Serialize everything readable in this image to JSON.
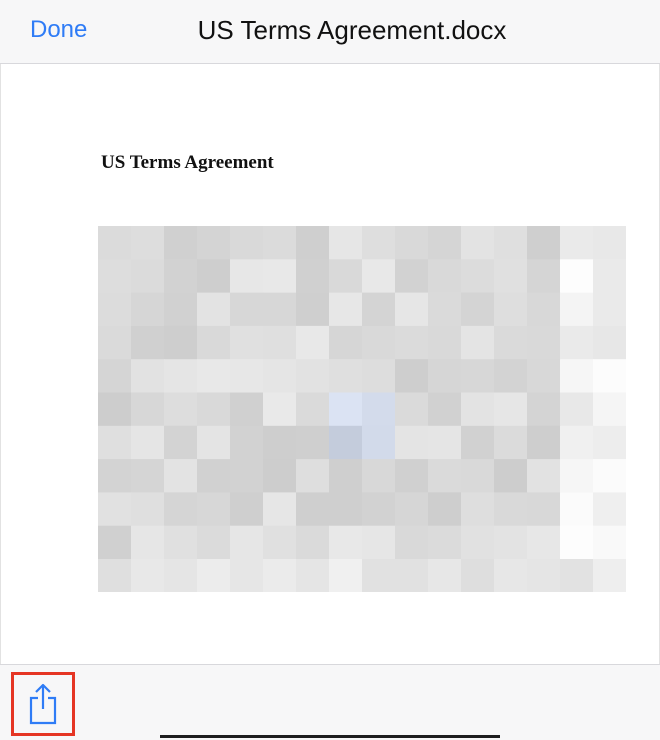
{
  "nav": {
    "done_label": "Done",
    "title": "US Terms Agreement.docx"
  },
  "document": {
    "heading": "US Terms Agreement",
    "body_redacted": true
  },
  "toolbar": {
    "share_icon": "share-icon",
    "highlight_color": "#e53524"
  },
  "colors": {
    "accent": "#2f7cf6"
  }
}
